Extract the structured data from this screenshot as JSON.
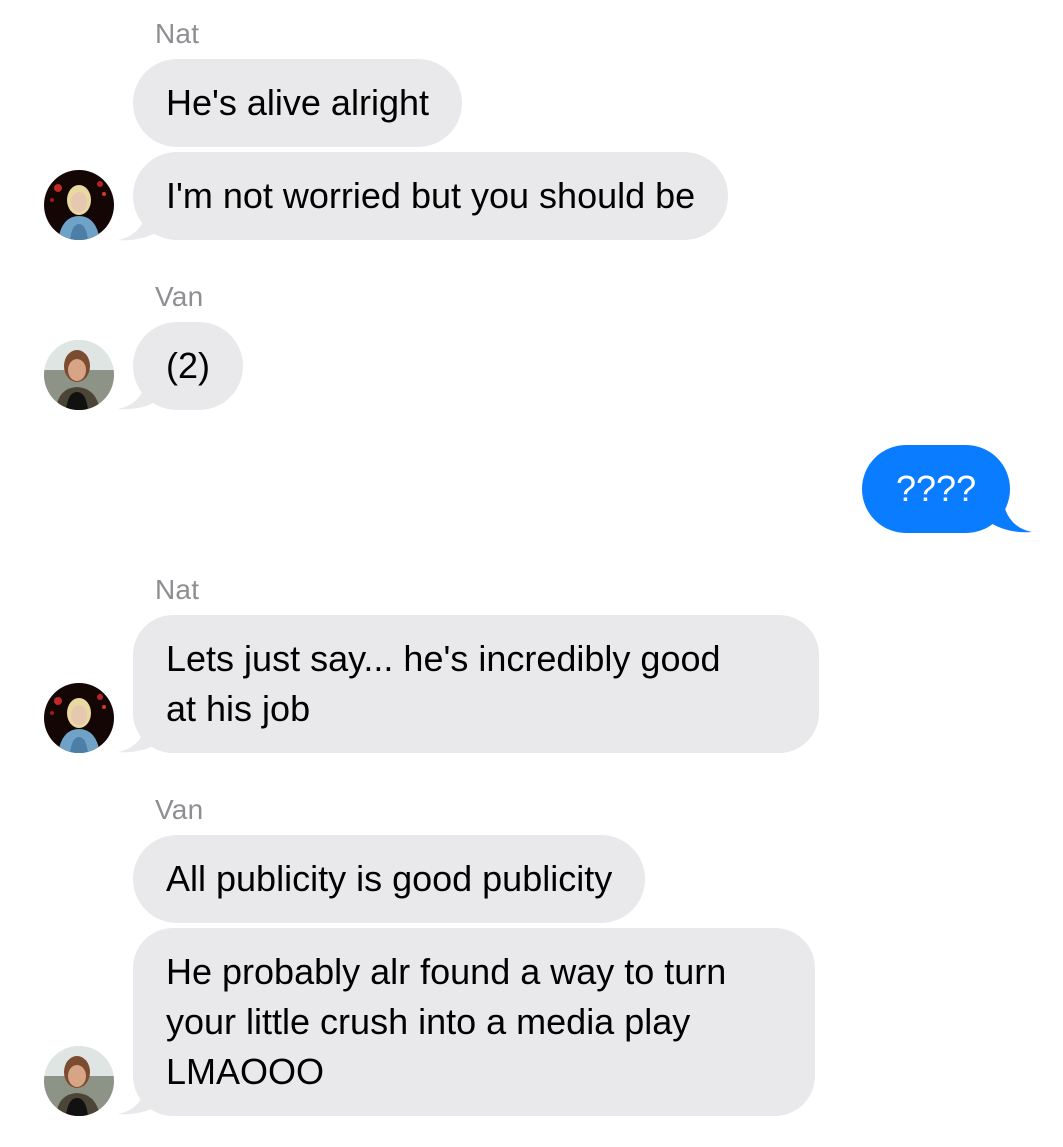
{
  "thread": {
    "messages": [
      {
        "sender": "Nat",
        "text": "He's alive alright"
      },
      {
        "text": "I'm not worried but you should be"
      },
      {
        "sender": "Van",
        "text": "(2)"
      },
      {
        "text": "????",
        "outgoing": true
      },
      {
        "sender": "Nat",
        "lines": [
          "Lets just say... he's incredibly good",
          "at his job"
        ]
      },
      {
        "sender": "Van",
        "text": "All publicity is good publicity"
      },
      {
        "lines": [
          "He probably alr found a way to turn",
          "your little crush into a media play",
          "LMAOOO"
        ]
      }
    ]
  },
  "avatars": {
    "nat": "nat-avatar",
    "van": "van-avatar"
  },
  "colors": {
    "incoming_bubble": "#e9e9eb",
    "outgoing_bubble": "#0a7cff",
    "sender_label": "#8e8e93"
  }
}
